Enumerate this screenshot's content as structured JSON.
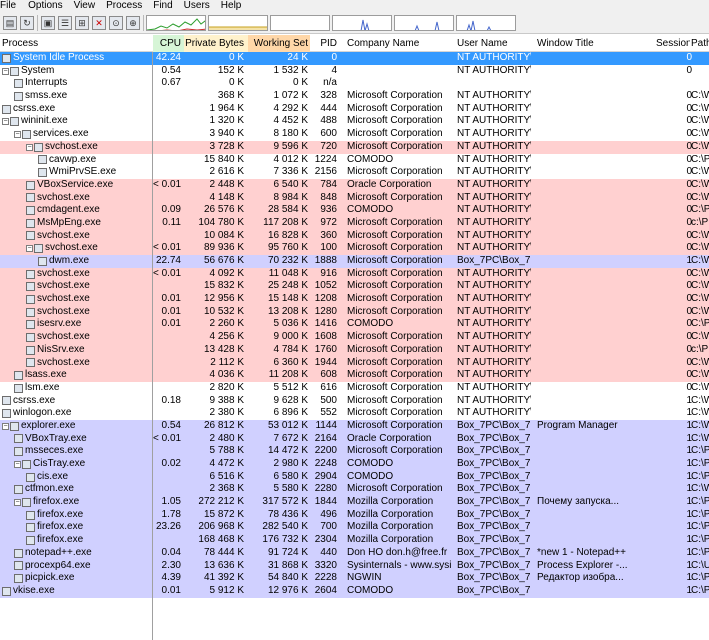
{
  "menu": [
    "File",
    "Options",
    "View",
    "Process",
    "Find",
    "Users",
    "Help"
  ],
  "toolbar": {
    "icons": [
      "save-icon",
      "refresh-icon",
      "window-icon",
      "properties-icon",
      "tree-icon",
      "kill-icon",
      "find-icon",
      "target-icon"
    ],
    "graphs": [
      "cpu-graph",
      "commit-graph",
      "io-graph",
      "network-graph",
      "disk-graph",
      "gpu-graph"
    ]
  },
  "columns": {
    "process": "Process",
    "cpu": "CPU",
    "private": "Private Bytes",
    "working": "Working Set",
    "pid": "PID",
    "company": "Company Name",
    "user": "User Name",
    "window": "Window Title",
    "session": "Session",
    "path": "Path"
  },
  "colors": {
    "cpu_header": "#d6f5d6",
    "private_header": "#fff2cc",
    "working_header": "#ffd7a8",
    "service": "#ffd0d0",
    "own": "#d0d0ff",
    "selected": "#3399ff"
  },
  "rows": [
    {
      "name": "System Idle Process",
      "level": 0,
      "cpu": "42.24",
      "private": "0 K",
      "working": "24 K",
      "pid": "0",
      "company": "",
      "user": "NT AUTHORITY\\...",
      "window": "",
      "session": "0",
      "path": "",
      "bg": "selected",
      "expander": ""
    },
    {
      "name": "System",
      "level": 0,
      "cpu": "0.54",
      "private": "152 K",
      "working": "1 532 K",
      "pid": "4",
      "company": "",
      "user": "NT AUTHORITY\\...",
      "window": "",
      "session": "0",
      "path": "",
      "bg": "system",
      "expander": "-"
    },
    {
      "name": "Interrupts",
      "level": 1,
      "cpu": "0.67",
      "private": "0 K",
      "working": "0 K",
      "pid": "n/a",
      "company": "",
      "user": "",
      "window": "",
      "session": "",
      "path": "",
      "bg": "system",
      "expander": ""
    },
    {
      "name": "smss.exe",
      "level": 1,
      "cpu": "",
      "private": "368 K",
      "working": "1 072 K",
      "pid": "328",
      "company": "Microsoft Corporation",
      "user": "NT AUTHORITY\\...",
      "window": "",
      "session": "0",
      "path": "C:\\W",
      "bg": "system",
      "expander": ""
    },
    {
      "name": "csrss.exe",
      "level": 0,
      "cpu": "",
      "private": "1 964 K",
      "working": "4 292 K",
      "pid": "444",
      "company": "Microsoft Corporation",
      "user": "NT AUTHORITY\\...",
      "window": "",
      "session": "0",
      "path": "C:\\W",
      "bg": "system",
      "expander": ""
    },
    {
      "name": "wininit.exe",
      "level": 0,
      "cpu": "",
      "private": "1 320 K",
      "working": "4 452 K",
      "pid": "488",
      "company": "Microsoft Corporation",
      "user": "NT AUTHORITY\\...",
      "window": "",
      "session": "0",
      "path": "C:\\W",
      "bg": "system",
      "expander": "-"
    },
    {
      "name": "services.exe",
      "level": 1,
      "cpu": "",
      "private": "3 940 K",
      "working": "8 180 K",
      "pid": "600",
      "company": "Microsoft Corporation",
      "user": "NT AUTHORITY\\...",
      "window": "",
      "session": "0",
      "path": "C:\\W",
      "bg": "system",
      "expander": "-"
    },
    {
      "name": "svchost.exe",
      "level": 2,
      "cpu": "",
      "private": "3 728 K",
      "working": "9 596 K",
      "pid": "720",
      "company": "Microsoft Corporation",
      "user": "NT AUTHORITY\\...",
      "window": "",
      "session": "0",
      "path": "C:\\W",
      "bg": "service",
      "expander": "-"
    },
    {
      "name": "cavwp.exe",
      "level": 3,
      "cpu": "",
      "private": "15 840 K",
      "working": "4 012 K",
      "pid": "1224",
      "company": "COMODO",
      "user": "NT AUTHORITY\\...",
      "window": "",
      "session": "0",
      "path": "C:\\P",
      "bg": "system",
      "expander": ""
    },
    {
      "name": "WmiPrvSE.exe",
      "level": 3,
      "cpu": "",
      "private": "2 616 K",
      "working": "7 336 K",
      "pid": "2156",
      "company": "Microsoft Corporation",
      "user": "NT AUTHORITY\\...",
      "window": "",
      "session": "0",
      "path": "C:\\W",
      "bg": "system",
      "expander": ""
    },
    {
      "name": "VBoxService.exe",
      "level": 2,
      "cpu": "< 0.01",
      "private": "2 448 K",
      "working": "6 540 K",
      "pid": "784",
      "company": "Oracle Corporation",
      "user": "NT AUTHORITY\\...",
      "window": "",
      "session": "0",
      "path": "C:\\W",
      "bg": "service",
      "expander": ""
    },
    {
      "name": "svchost.exe",
      "level": 2,
      "cpu": "",
      "private": "4 148 K",
      "working": "8 984 K",
      "pid": "848",
      "company": "Microsoft Corporation",
      "user": "NT AUTHORITY\\...",
      "window": "",
      "session": "0",
      "path": "C:\\W",
      "bg": "service",
      "expander": ""
    },
    {
      "name": "cmdagent.exe",
      "level": 2,
      "cpu": "0.09",
      "private": "26 576 K",
      "working": "28 584 K",
      "pid": "936",
      "company": "COMODO",
      "user": "NT AUTHORITY\\...",
      "window": "",
      "session": "0",
      "path": "C:\\P",
      "bg": "service",
      "expander": ""
    },
    {
      "name": "MsMpEng.exe",
      "level": 2,
      "cpu": "0.11",
      "private": "104 780 K",
      "working": "117 208 K",
      "pid": "972",
      "company": "Microsoft Corporation",
      "user": "NT AUTHORITY\\...",
      "window": "",
      "session": "0",
      "path": "c:\\P",
      "bg": "service",
      "expander": ""
    },
    {
      "name": "svchost.exe",
      "level": 2,
      "cpu": "",
      "private": "10 084 K",
      "working": "16 828 K",
      "pid": "360",
      "company": "Microsoft Corporation",
      "user": "NT AUTHORITY\\...",
      "window": "",
      "session": "0",
      "path": "C:\\W",
      "bg": "service",
      "expander": ""
    },
    {
      "name": "svchost.exe",
      "level": 2,
      "cpu": "< 0.01",
      "private": "89 936 K",
      "working": "95 760 K",
      "pid": "100",
      "company": "Microsoft Corporation",
      "user": "NT AUTHORITY\\...",
      "window": "",
      "session": "0",
      "path": "C:\\W",
      "bg": "service",
      "expander": "-"
    },
    {
      "name": "dwm.exe",
      "level": 3,
      "cpu": "22.74",
      "private": "56 676 K",
      "working": "70 232 K",
      "pid": "1888",
      "company": "Microsoft Corporation",
      "user": "Box_7PC\\Box_7",
      "window": "",
      "session": "1",
      "path": "C:\\W",
      "bg": "dwm",
      "expander": ""
    },
    {
      "name": "svchost.exe",
      "level": 2,
      "cpu": "< 0.01",
      "private": "4 092 K",
      "working": "11 048 K",
      "pid": "916",
      "company": "Microsoft Corporation",
      "user": "NT AUTHORITY\\...",
      "window": "",
      "session": "0",
      "path": "C:\\W",
      "bg": "service",
      "expander": ""
    },
    {
      "name": "svchost.exe",
      "level": 2,
      "cpu": "",
      "private": "15 832 K",
      "working": "25 248 K",
      "pid": "1052",
      "company": "Microsoft Corporation",
      "user": "NT AUTHORITY\\...",
      "window": "",
      "session": "0",
      "path": "C:\\W",
      "bg": "service",
      "expander": ""
    },
    {
      "name": "svchost.exe",
      "level": 2,
      "cpu": "0.01",
      "private": "12 956 K",
      "working": "15 148 K",
      "pid": "1208",
      "company": "Microsoft Corporation",
      "user": "NT AUTHORITY\\...",
      "window": "",
      "session": "0",
      "path": "C:\\W",
      "bg": "service",
      "expander": ""
    },
    {
      "name": "svchost.exe",
      "level": 2,
      "cpu": "0.01",
      "private": "10 532 K",
      "working": "13 208 K",
      "pid": "1280",
      "company": "Microsoft Corporation",
      "user": "NT AUTHORITY\\...",
      "window": "",
      "session": "0",
      "path": "C:\\W",
      "bg": "service",
      "expander": ""
    },
    {
      "name": "isesrv.exe",
      "level": 2,
      "cpu": "0.01",
      "private": "2 260 K",
      "working": "5 036 K",
      "pid": "1416",
      "company": "COMODO",
      "user": "NT AUTHORITY\\...",
      "window": "",
      "session": "0",
      "path": "C:\\P",
      "bg": "service",
      "expander": ""
    },
    {
      "name": "svchost.exe",
      "level": 2,
      "cpu": "",
      "private": "4 256 K",
      "working": "9 000 K",
      "pid": "1608",
      "company": "Microsoft Corporation",
      "user": "NT AUTHORITY\\...",
      "window": "",
      "session": "0",
      "path": "C:\\W",
      "bg": "service",
      "expander": ""
    },
    {
      "name": "NisSrv.exe",
      "level": 2,
      "cpu": "",
      "private": "13 428 K",
      "working": "4 784 K",
      "pid": "1760",
      "company": "Microsoft Corporation",
      "user": "NT AUTHORITY\\...",
      "window": "",
      "session": "0",
      "path": "c:\\P",
      "bg": "service",
      "expander": ""
    },
    {
      "name": "svchost.exe",
      "level": 2,
      "cpu": "",
      "private": "2 112 K",
      "working": "6 360 K",
      "pid": "1944",
      "company": "Microsoft Corporation",
      "user": "NT AUTHORITY\\...",
      "window": "",
      "session": "0",
      "path": "C:\\W",
      "bg": "service",
      "expander": ""
    },
    {
      "name": "lsass.exe",
      "level": 1,
      "cpu": "",
      "private": "4 036 K",
      "working": "11 208 K",
      "pid": "608",
      "company": "Microsoft Corporation",
      "user": "NT AUTHORITY\\...",
      "window": "",
      "session": "0",
      "path": "C:\\W",
      "bg": "service",
      "expander": ""
    },
    {
      "name": "lsm.exe",
      "level": 1,
      "cpu": "",
      "private": "2 820 K",
      "working": "5 512 K",
      "pid": "616",
      "company": "Microsoft Corporation",
      "user": "NT AUTHORITY\\...",
      "window": "",
      "session": "0",
      "path": "C:\\W",
      "bg": "system",
      "expander": ""
    },
    {
      "name": "csrss.exe",
      "level": 0,
      "cpu": "0.18",
      "private": "9 388 K",
      "working": "9 628 K",
      "pid": "500",
      "company": "Microsoft Corporation",
      "user": "NT AUTHORITY\\...",
      "window": "",
      "session": "1",
      "path": "C:\\W",
      "bg": "system",
      "expander": ""
    },
    {
      "name": "winlogon.exe",
      "level": 0,
      "cpu": "",
      "private": "2 380 K",
      "working": "6 896 K",
      "pid": "552",
      "company": "Microsoft Corporation",
      "user": "NT AUTHORITY\\...",
      "window": "",
      "session": "1",
      "path": "C:\\W",
      "bg": "system",
      "expander": ""
    },
    {
      "name": "explorer.exe",
      "level": 0,
      "cpu": "0.54",
      "private": "26 812 K",
      "working": "53 012 K",
      "pid": "1144",
      "company": "Microsoft Corporation",
      "user": "Box_7PC\\Box_7",
      "window": "Program Manager",
      "session": "1",
      "path": "C:\\W",
      "bg": "own",
      "expander": "-"
    },
    {
      "name": "VBoxTray.exe",
      "level": 1,
      "cpu": "< 0.01",
      "private": "2 480 K",
      "working": "7 672 K",
      "pid": "2164",
      "company": "Oracle Corporation",
      "user": "Box_7PC\\Box_7",
      "window": "",
      "session": "1",
      "path": "C:\\W",
      "bg": "own",
      "expander": ""
    },
    {
      "name": "msseces.exe",
      "level": 1,
      "cpu": "",
      "private": "5 788 K",
      "working": "14 472 K",
      "pid": "2200",
      "company": "Microsoft Corporation",
      "user": "Box_7PC\\Box_7",
      "window": "",
      "session": "1",
      "path": "C:\\P",
      "bg": "own",
      "expander": ""
    },
    {
      "name": "CisTray.exe",
      "level": 1,
      "cpu": "0.02",
      "private": "4 472 K",
      "working": "2 980 K",
      "pid": "2248",
      "company": "COMODO",
      "user": "Box_7PC\\Box_7",
      "window": "",
      "session": "1",
      "path": "C:\\P",
      "bg": "own",
      "expander": "-"
    },
    {
      "name": "cis.exe",
      "level": 2,
      "cpu": "",
      "private": "6 516 K",
      "working": "6 580 K",
      "pid": "2904",
      "company": "COMODO",
      "user": "Box_7PC\\Box_7",
      "window": "",
      "session": "1",
      "path": "C:\\P",
      "bg": "own",
      "expander": ""
    },
    {
      "name": "ctfmon.exe",
      "level": 1,
      "cpu": "",
      "private": "2 368 K",
      "working": "5 580 K",
      "pid": "2280",
      "company": "Microsoft Corporation",
      "user": "Box_7PC\\Box_7",
      "window": "",
      "session": "1",
      "path": "C:\\W",
      "bg": "own",
      "expander": ""
    },
    {
      "name": "firefox.exe",
      "level": 1,
      "cpu": "1.05",
      "private": "272 212 K",
      "working": "317 572 K",
      "pid": "1844",
      "company": "Mozilla Corporation",
      "user": "Box_7PC\\Box_7",
      "window": "Почему запуска...",
      "session": "1",
      "path": "C:\\P",
      "bg": "own",
      "expander": "-"
    },
    {
      "name": "firefox.exe",
      "level": 2,
      "cpu": "1.78",
      "private": "15 872 K",
      "working": "78 436 K",
      "pid": "496",
      "company": "Mozilla Corporation",
      "user": "Box_7PC\\Box_7",
      "window": "",
      "session": "1",
      "path": "C:\\P",
      "bg": "own",
      "expander": ""
    },
    {
      "name": "firefox.exe",
      "level": 2,
      "cpu": "23.26",
      "private": "206 968 K",
      "working": "282 540 K",
      "pid": "700",
      "company": "Mozilla Corporation",
      "user": "Box_7PC\\Box_7",
      "window": "",
      "session": "1",
      "path": "C:\\P",
      "bg": "own",
      "expander": ""
    },
    {
      "name": "firefox.exe",
      "level": 2,
      "cpu": "",
      "private": "168 468 K",
      "working": "176 732 K",
      "pid": "2304",
      "company": "Mozilla Corporation",
      "user": "Box_7PC\\Box_7",
      "window": "",
      "session": "1",
      "path": "C:\\P",
      "bg": "own",
      "expander": ""
    },
    {
      "name": "notepad++.exe",
      "level": 1,
      "cpu": "0.04",
      "private": "78 444 K",
      "working": "91 724 K",
      "pid": "440",
      "company": "Don HO don.h@free.fr",
      "user": "Box_7PC\\Box_7",
      "window": "*new 1 - Notepad++",
      "session": "1",
      "path": "C:\\P",
      "bg": "own",
      "expander": ""
    },
    {
      "name": "procexp64.exe",
      "level": 1,
      "cpu": "2.30",
      "private": "13 636 K",
      "working": "31 868 K",
      "pid": "3320",
      "company": "Sysinternals - www.sysinter...",
      "user": "Box_7PC\\Box_7",
      "window": "Process Explorer -...",
      "session": "1",
      "path": "C:\\U",
      "bg": "own",
      "expander": ""
    },
    {
      "name": "picpick.exe",
      "level": 1,
      "cpu": "4.39",
      "private": "41 392 K",
      "working": "54 840 K",
      "pid": "2228",
      "company": "NGWIN",
      "user": "Box_7PC\\Box_7",
      "window": "Редактор изобра...",
      "session": "1",
      "path": "C:\\P",
      "bg": "own",
      "expander": ""
    },
    {
      "name": "vkise.exe",
      "level": 0,
      "cpu": "0.01",
      "private": "5 912 K",
      "working": "12 976 K",
      "pid": "2604",
      "company": "COMODO",
      "user": "Box_7PC\\Box_7",
      "window": "",
      "session": "1",
      "path": "C:\\P",
      "bg": "own",
      "expander": ""
    }
  ]
}
